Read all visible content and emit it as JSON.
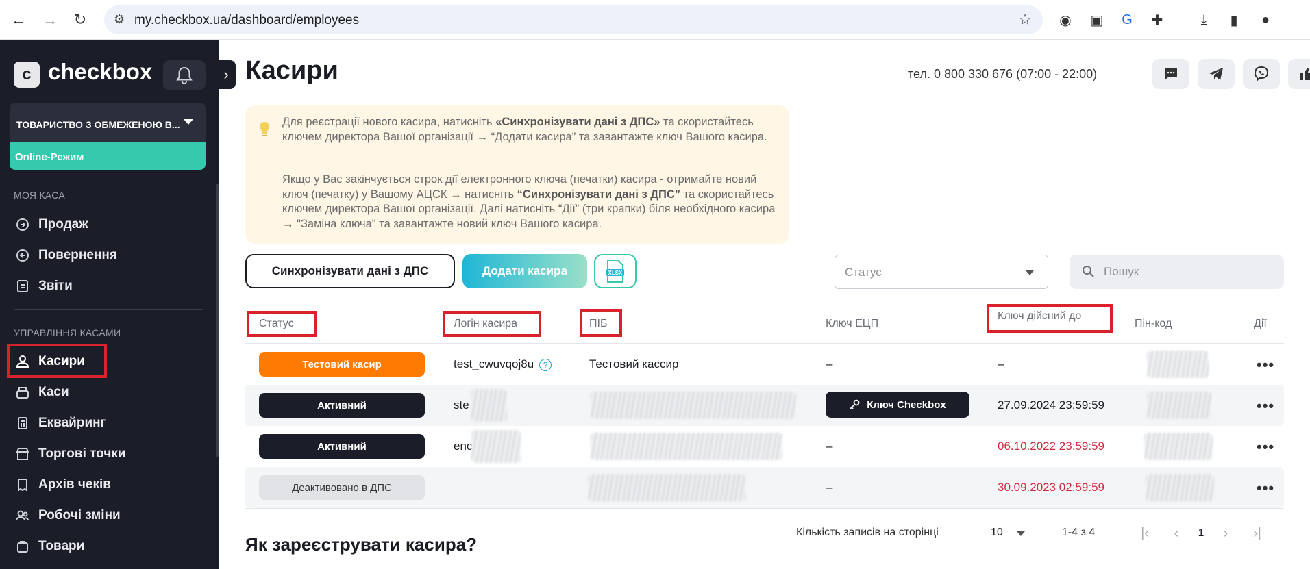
{
  "browser": {
    "url": "my.checkbox.ua/dashboard/employees"
  },
  "sidebar": {
    "logo": "checkbox",
    "logo_letter": "c",
    "org_name": "ТОВАРИСТВО З ОБМЕЖЕНОЮ В...",
    "mode": "Online-Режим",
    "section_1": "МОЯ КАСА",
    "section_2": "УПРАВЛІННЯ КАСАМИ",
    "items": [
      {
        "label": "Продаж",
        "icon": "cart-icon"
      },
      {
        "label": "Повернення",
        "icon": "return-icon"
      },
      {
        "label": "Звіти",
        "icon": "report-icon"
      },
      {
        "label": "Касири",
        "icon": "cashiers-icon"
      },
      {
        "label": "Каси",
        "icon": "cash-register-icon"
      },
      {
        "label": "Еквайринг",
        "icon": "acquiring-icon"
      },
      {
        "label": "Торгові точки",
        "icon": "store-icon"
      },
      {
        "label": "Архів чеків",
        "icon": "receipt-archive-icon"
      },
      {
        "label": "Робочі зміни",
        "icon": "shifts-icon"
      },
      {
        "label": "Товари",
        "icon": "goods-icon"
      }
    ]
  },
  "header": {
    "title": "Касири",
    "phone": "тел. 0 800 330 676 (07:00 - 22:00)"
  },
  "info": {
    "p1_a": "Для реєстрації нового касира, натисніть ",
    "p1_b": "«Синхронізувати дані з ДПС»",
    "p1_c": " та скористайтесь ключем директора Вашої організації → “Додати касира” та завантажте ключ Вашого касира.",
    "p2_a": "Якщо у Вас закінчується строк дії електронного ключа (печатки) касира - отримайте новий ключ (печатку) у Вашому АЦСК → натисніть ",
    "p2_b": "“Синхронізувати дані з ДПС”",
    "p2_c": " та скористайтесь ключем директора Вашої організації. Далі натисніть “Дії” (три крапки) біля необхідного касира → \"Заміна ключа\" та завантажте новий ключ Вашого касира."
  },
  "toolbar": {
    "sync_label": "Синхронізувати дані з ДПС",
    "add_label": "Додати касира",
    "xlsx_label": "XLSX",
    "status_placeholder": "Статус",
    "search_placeholder": "Пошук"
  },
  "table": {
    "headers": [
      "Статус",
      "Логін касира",
      "ПІБ",
      "Ключ ЕЦП",
      "Ключ дійсний до",
      "Пін-код",
      "Дії"
    ],
    "rows": [
      {
        "status": "Тестовий касир",
        "status_color": "#ff7a00",
        "login": "test_cwuvqoj8u",
        "name": "Тестовий кассир",
        "key": "–",
        "valid_until": "–",
        "expired": false
      },
      {
        "status": "Активний",
        "status_color": "#1b1e29",
        "login": "ste",
        "name": "",
        "key": "Ключ Checkbox",
        "valid_until": "27.09.2024 23:59:59",
        "expired": false
      },
      {
        "status": "Активний",
        "status_color": "#1b1e29",
        "login": "enc",
        "name": "",
        "key": "–",
        "valid_until": "06.10.2022 23:59:59",
        "expired": true
      },
      {
        "status": "Деактивовано в ДПС",
        "status_color": "#e1e3e7",
        "login": "",
        "name": "",
        "key": "–",
        "valid_until": "30.09.2023 02:59:59",
        "expired": true
      }
    ],
    "actions_glyph": "•••"
  },
  "pagination": {
    "per_page_label": "Кількість записів на сторінці",
    "per_page": "10",
    "range": "1-4 з 4",
    "page": "1"
  },
  "how_title": "Як зареєструвати касира?",
  "colors": {
    "sidebar_bg": "#1b1e29",
    "accent": "#36c9ae",
    "highlight": "#d8232a",
    "expired": "#d02c40"
  }
}
